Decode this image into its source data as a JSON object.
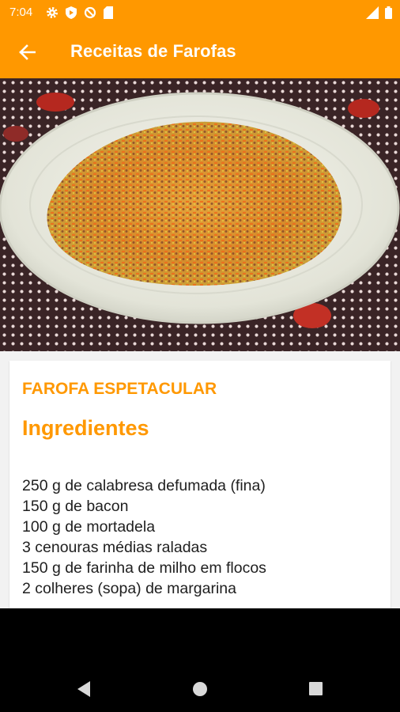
{
  "status_bar": {
    "time": "7:04",
    "left_icons": [
      "gear-icon",
      "play-protect-icon",
      "no-sync-icon",
      "sd-card-icon"
    ],
    "right_icons": [
      "cell-signal-icon",
      "battery-icon"
    ]
  },
  "app_bar": {
    "back_icon": "arrow-back-icon",
    "title": "Receitas de Farofas"
  },
  "hero_image": {
    "description_icon": "farofa-dish-photo"
  },
  "recipe": {
    "title": "FAROFA ESPETACULAR",
    "section_title": "Ingredientes",
    "ingredients": [
      "250 g de calabresa defumada (fina)",
      "150 g de bacon",
      "100 g de mortadela",
      "3 cenouras médias raladas",
      "150 g de farinha de milho em flocos",
      "2 colheres (sopa) de margarina"
    ]
  },
  "colors": {
    "accent": "#ff9800",
    "text": "#202020"
  },
  "nav_bar": {
    "icons": [
      "back-triangle-icon",
      "home-circle-icon",
      "recents-square-icon"
    ]
  }
}
